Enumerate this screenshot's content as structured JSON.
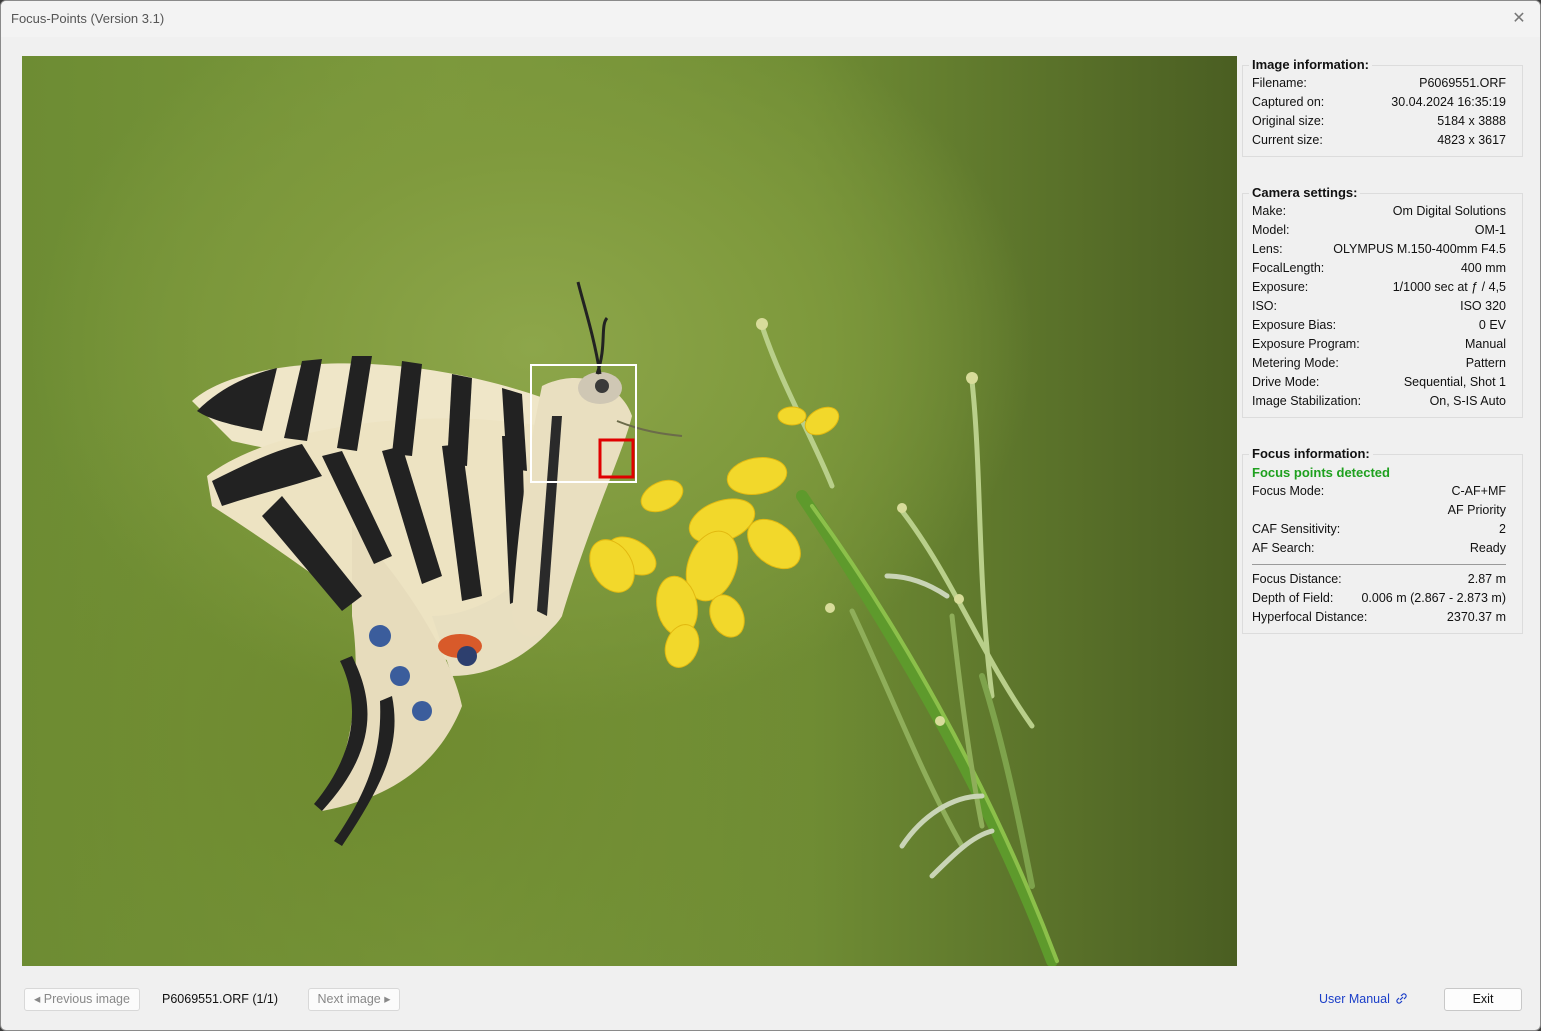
{
  "window": {
    "title": "Focus-Points (Version 3.1)",
    "close_glyph": "✕"
  },
  "image_info": {
    "title": "Image information:",
    "rows": [
      {
        "label": "Filename:",
        "value": "P6069551.ORF"
      },
      {
        "label": "Captured on:",
        "value": "30.04.2024 16:35:19"
      },
      {
        "label": "Original size:",
        "value": "5184 x 3888"
      },
      {
        "label": "Current size:",
        "value": "4823 x 3617"
      }
    ]
  },
  "camera": {
    "title": "Camera settings:",
    "rows": [
      {
        "label": "Make:",
        "value": "Om Digital Solutions"
      },
      {
        "label": "Model:",
        "value": "OM-1"
      },
      {
        "label": "Lens:",
        "value": "OLYMPUS M.150-400mm F4.5"
      },
      {
        "label": "FocalLength:",
        "value": "400 mm"
      },
      {
        "label": "Exposure:",
        "value": "1/1000 sec at ƒ / 4,5"
      },
      {
        "label": "ISO:",
        "value": "ISO 320"
      },
      {
        "label": "Exposure Bias:",
        "value": "0 EV"
      },
      {
        "label": "Exposure Program:",
        "value": "Manual"
      },
      {
        "label": "Metering Mode:",
        "value": "Pattern"
      },
      {
        "label": "Drive Mode:",
        "value": "Sequential, Shot 1"
      },
      {
        "label": "Image Stabilization:",
        "value": "On, S-IS Auto"
      }
    ]
  },
  "focus": {
    "title": "Focus information:",
    "status": "Focus points detected",
    "status_color": "#1fa01f",
    "rows_top": [
      {
        "label": "Focus Mode:",
        "value": "C-AF+MF"
      },
      {
        "label": "",
        "value": "AF Priority"
      },
      {
        "label": "CAF Sensitivity:",
        "value": "2"
      },
      {
        "label": "AF Search:",
        "value": "Ready"
      }
    ],
    "rows_bottom": [
      {
        "label": "Focus Distance:",
        "value": "2.87 m"
      },
      {
        "label": "Depth of Field:",
        "value": "0.006 m (2.867 - 2.873 m)"
      },
      {
        "label": "Hyperfocal Distance:",
        "value": "2370.37 m"
      }
    ]
  },
  "bottom": {
    "prev_label": "◂ Previous image",
    "file_label": "P6069551.ORF (1/1)",
    "next_label": "Next image ▸",
    "manual_label": "User Manual",
    "manual_icon": "link-icon",
    "exit_label": "Exit",
    "link_color": "#1a3ec8"
  },
  "overlay": {
    "focus_frame_color": "#ffffff",
    "focus_point_color": "#e00000"
  }
}
